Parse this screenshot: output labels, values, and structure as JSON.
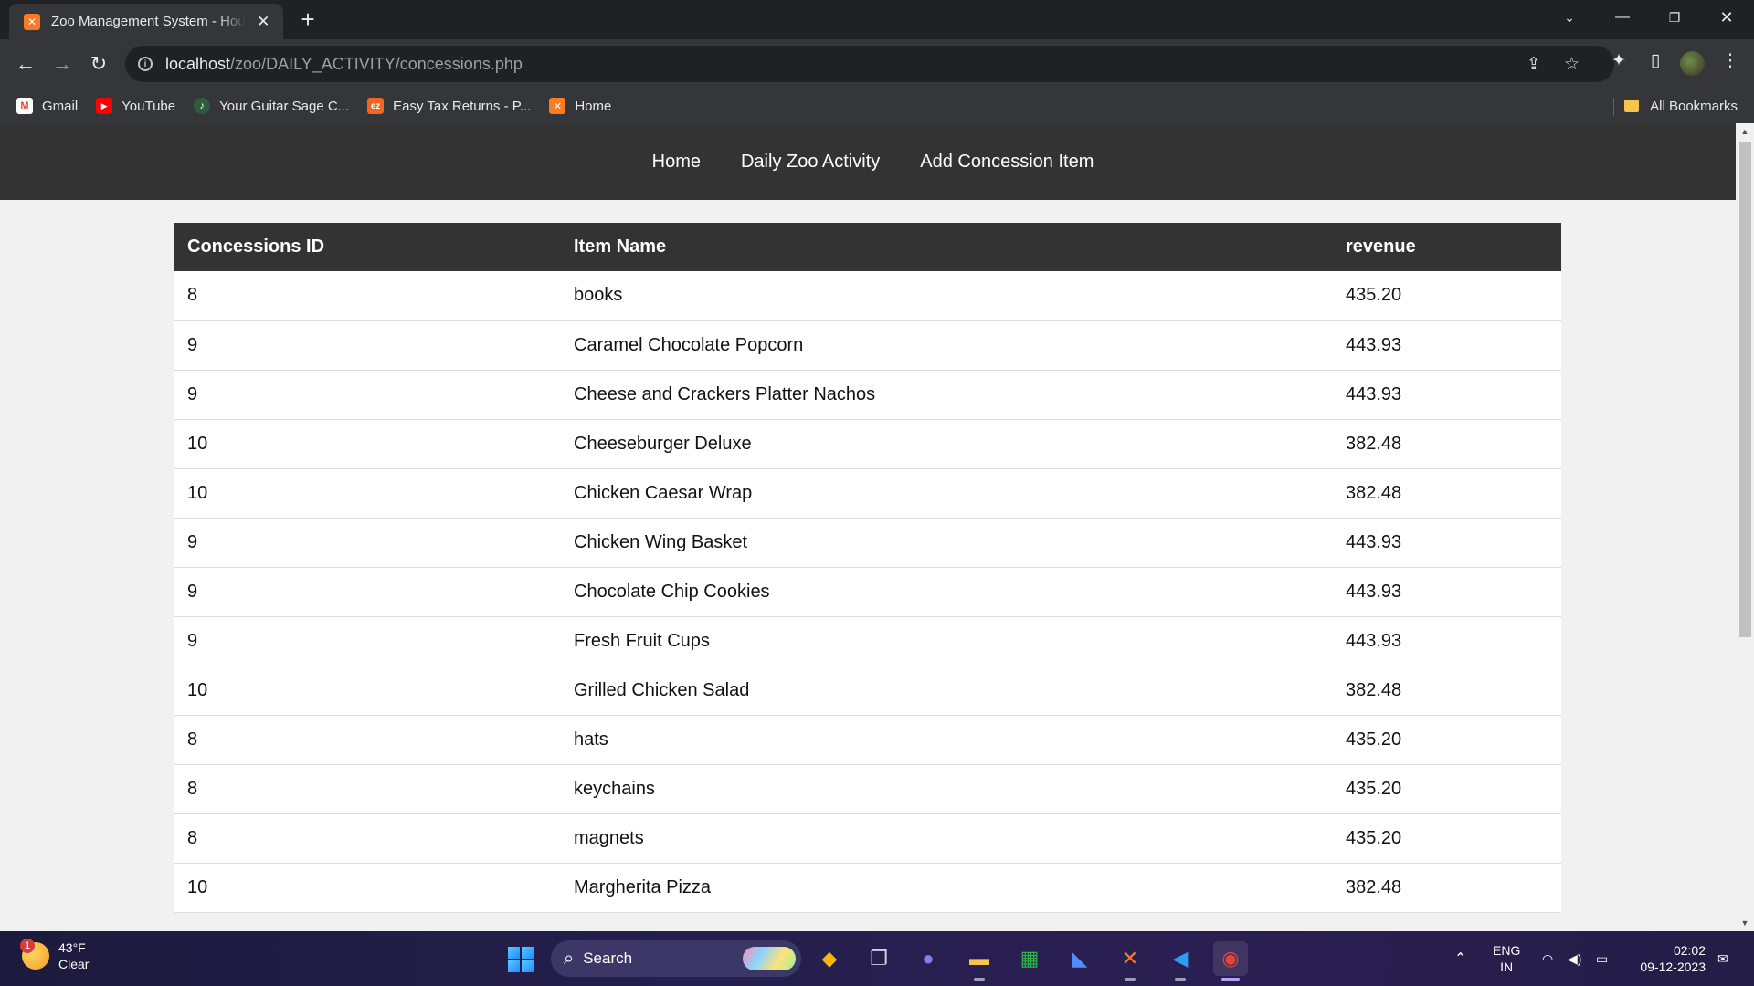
{
  "browser": {
    "tab_title": "Zoo Management System - Hou",
    "tab_favicon": "xampp-icon",
    "url_host": "localhost",
    "url_path": "/zoo/DAILY_ACTIVITY/concessions.php",
    "bookmarks": [
      {
        "label": "Gmail",
        "icon": "gmail-icon",
        "color": "#ea4335",
        "glyph": "M"
      },
      {
        "label": "YouTube",
        "icon": "youtube-icon",
        "color": "#ff0000",
        "glyph": "▶"
      },
      {
        "label": "Your Guitar Sage C...",
        "icon": "guitar-sage-icon",
        "color": "#2d5b3b",
        "glyph": "♪"
      },
      {
        "label": "Easy Tax Returns - P...",
        "icon": "ez-tax-icon",
        "color": "#f26522",
        "glyph": "ez"
      },
      {
        "label": "Home",
        "icon": "xampp-icon",
        "color": "#fb7a24",
        "glyph": "✕"
      }
    ],
    "all_bookmarks": "All Bookmarks"
  },
  "site_nav": {
    "items": [
      "Home",
      "Daily Zoo Activity",
      "Add Concession Item"
    ]
  },
  "table": {
    "headers": [
      "Concessions ID",
      "Item Name",
      "revenue"
    ],
    "rows": [
      [
        "8",
        "books",
        "435.20"
      ],
      [
        "9",
        "Caramel Chocolate Popcorn",
        "443.93"
      ],
      [
        "9",
        "Cheese and Crackers Platter Nachos",
        "443.93"
      ],
      [
        "10",
        "Cheeseburger Deluxe",
        "382.48"
      ],
      [
        "10",
        "Chicken Caesar Wrap",
        "382.48"
      ],
      [
        "9",
        "Chicken Wing Basket",
        "443.93"
      ],
      [
        "9",
        "Chocolate Chip Cookies",
        "443.93"
      ],
      [
        "9",
        "Fresh Fruit Cups",
        "443.93"
      ],
      [
        "10",
        "Grilled Chicken Salad",
        "382.48"
      ],
      [
        "8",
        "hats",
        "435.20"
      ],
      [
        "8",
        "keychains",
        "435.20"
      ],
      [
        "8",
        "magnets",
        "435.20"
      ],
      [
        "10",
        "Margherita Pizza",
        "382.48"
      ]
    ]
  },
  "taskbar": {
    "weather_temp": "43°F",
    "weather_desc": "Clear",
    "weather_badge": "1",
    "search_placeholder": "Search",
    "lang_line1": "ENG",
    "lang_line2": "IN",
    "time": "02:02",
    "date": "09-12-2023"
  },
  "colors": {
    "nav_bg": "#333333",
    "header_bg": "#333333",
    "page_bg": "#f1f1f1",
    "xampp_orange": "#fb7a24"
  }
}
